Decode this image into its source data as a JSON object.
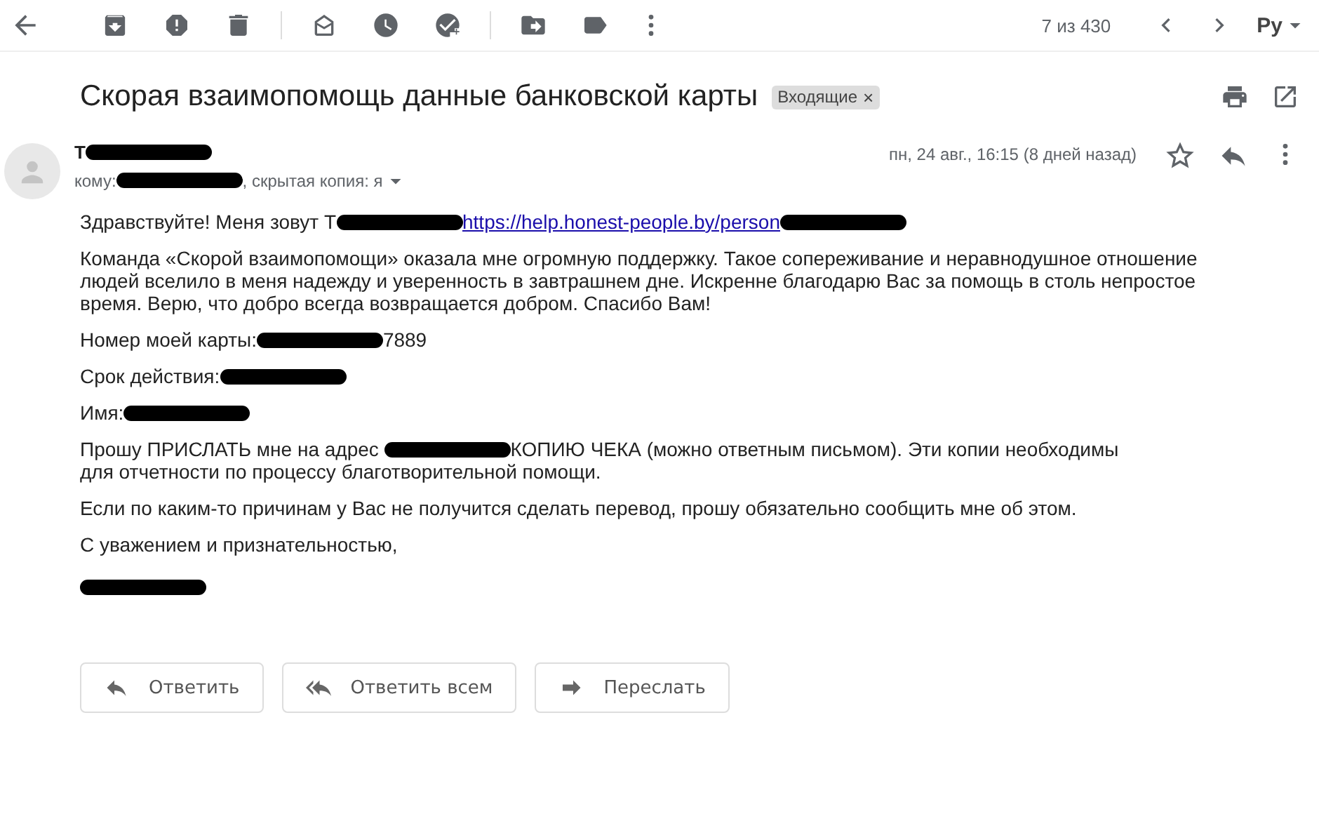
{
  "toolbar": {
    "counter": "7 из 430",
    "language": "Ру"
  },
  "subject": {
    "title": "Скорая взаимопомощь данные банковской карты",
    "label": "Входящие",
    "label_close": "×"
  },
  "message": {
    "sender": [
      {
        "kind": "text",
        "text": "Т"
      },
      {
        "kind": "redaction"
      }
    ],
    "recipients": [
      {
        "kind": "text",
        "text": "кому:"
      },
      {
        "kind": "redaction"
      },
      {
        "kind": "text",
        "text": ", скрытая копия: я"
      }
    ],
    "date": "пн, 24 авг., 16:15 (8 дней назад)",
    "starred": false,
    "body": [
      [
        {
          "kind": "text",
          "text": "Здравствуйте! Меня зовут Т"
        },
        {
          "kind": "redaction"
        },
        {
          "kind": "link",
          "text": "https://help.honest-people.by/person"
        },
        {
          "kind": "redaction"
        }
      ],
      [
        {
          "kind": "text",
          "text": "Команда «Скорой взаимопомощи» оказала мне огромную поддержку. Такое сопереживание и неравнодушное отношение людей вселило в меня надежду и уверенность в завтрашнем дне. Искренне благодарю Вас за помощь в столь непростое время. Верю, что добро всегда возвращается добром. Спасибо Вам!"
        }
      ],
      [
        {
          "kind": "text",
          "text": "Номер моей карты:"
        },
        {
          "kind": "redaction"
        },
        {
          "kind": "text",
          "text": "7889"
        }
      ],
      [
        {
          "kind": "text",
          "text": "Срок действия:"
        },
        {
          "kind": "redaction"
        }
      ],
      [
        {
          "kind": "text",
          "text": "Имя:"
        },
        {
          "kind": "redaction"
        }
      ],
      [
        {
          "kind": "text",
          "text": "Прошу ПРИСЛАТЬ мне на адрес "
        },
        {
          "kind": "redaction"
        },
        {
          "kind": "text",
          "text": "КОПИЮ ЧЕКА (можно ответным письмом). Эти копии необходимы"
        },
        {
          "kind": "text_line",
          "text": "для отчетности по процессу благотворительной помощи."
        }
      ],
      [
        {
          "kind": "text",
          "text": "Если по каким-то причинам у Вас не получится сделать перевод, прошу обязательно сообщить мне об этом."
        }
      ],
      [
        {
          "kind": "text",
          "text": "С уважением и признательностью,"
        }
      ],
      [
        {
          "kind": "redaction"
        }
      ]
    ]
  },
  "actions": [
    {
      "kind": "reply",
      "label": "Ответить"
    },
    {
      "kind": "reply_all",
      "label": "Ответить всем"
    },
    {
      "kind": "forward",
      "label": "Переслать"
    }
  ]
}
